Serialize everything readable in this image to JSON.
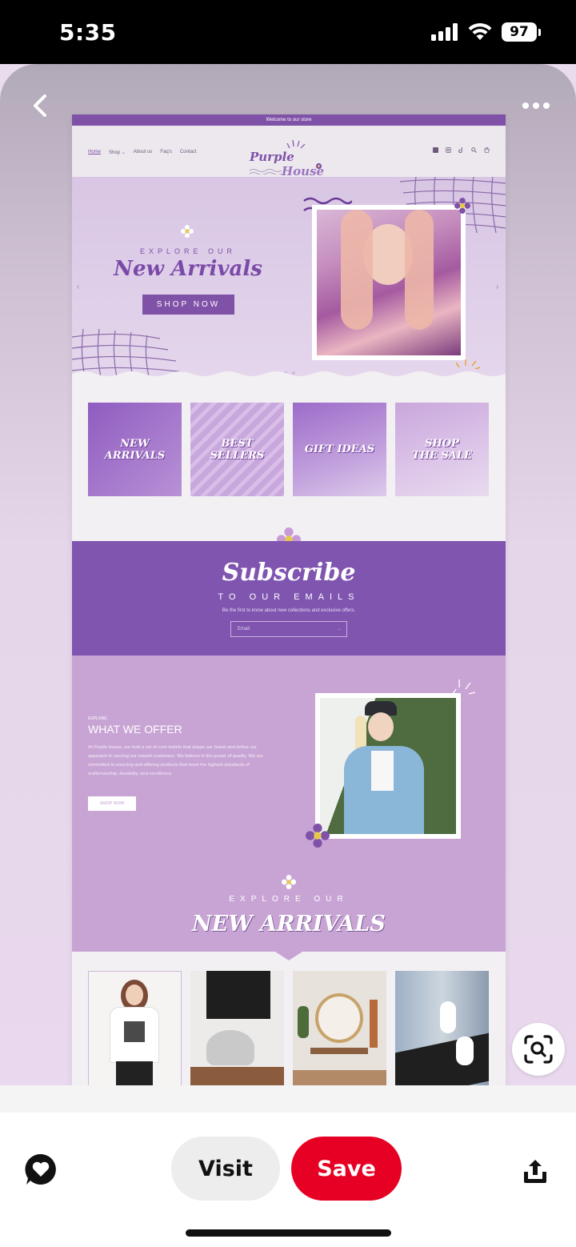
{
  "status_bar": {
    "time": "5:35",
    "battery": "97"
  },
  "pin": {
    "website": {
      "announcement": "Welcome to our store",
      "nav": [
        "Home",
        "Shop ⌄",
        "About us",
        "Faq's",
        "Contact"
      ],
      "logo": {
        "line1": "Purple",
        "line2": "House"
      },
      "hero": {
        "kicker": "EXPLORE OUR",
        "title": "New Arrivals",
        "button": "SHOP NOW"
      },
      "categories": [
        {
          "line1": "NEW",
          "line2": "ARRIVALS"
        },
        {
          "line1": "BEST",
          "line2": "SELLERS"
        },
        {
          "line1": "GIFT IDEAS",
          "line2": ""
        },
        {
          "line1": "SHOP",
          "line2": "THE SALE"
        }
      ],
      "subscribe": {
        "title": "Subscribe",
        "kicker": "TO OUR EMAILS",
        "desc": "Be the first to know about new collections and exclusive offers.",
        "placeholder": "Email",
        "arrow": "→"
      },
      "offer": {
        "kicker": "EXPLORE",
        "title": "WHAT WE OFFER",
        "body": "At Purple House, we hold a set of core beliefs that shape our brand and define our approach to serving our valued customers. We believe in the power of quality. We are committed to sourcing and offering products that meet the highest standards of craftsmanship, durability, and excellence.",
        "button": "SHOP NOW"
      },
      "arrivals": {
        "kicker": "EXPLORE OUR",
        "title": "NEW ARRIVALS"
      }
    }
  },
  "actions": {
    "visit": "Visit",
    "save": "Save"
  },
  "colors": {
    "brand_purple": "#7f51a7",
    "save_red": "#e60023",
    "lavender": "#c8a4d4"
  }
}
